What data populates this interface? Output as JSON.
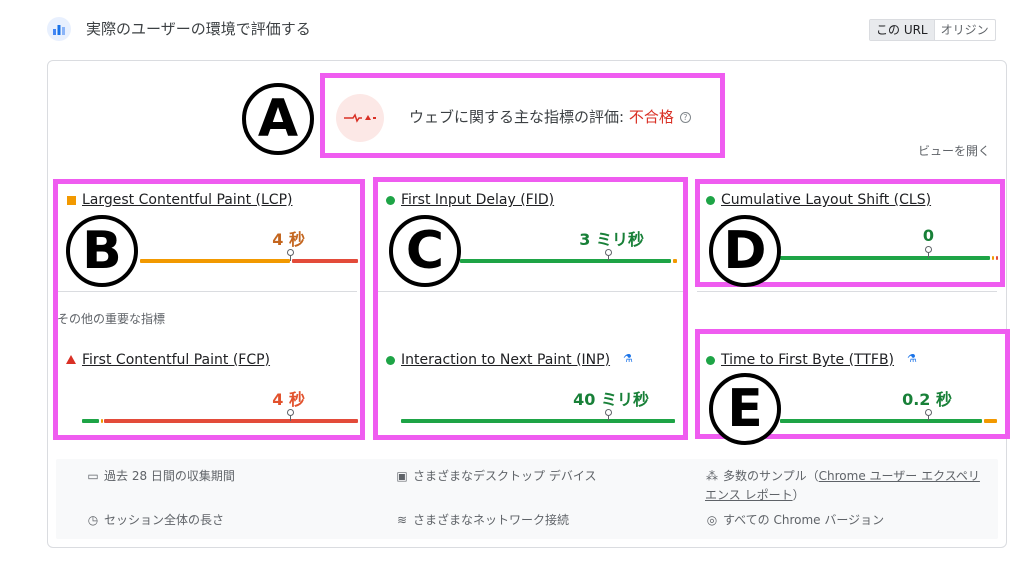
{
  "header": {
    "title": "実際のユーザーの環境で評価する",
    "toggle": [
      "この URL",
      "オリジン"
    ]
  },
  "assessment": {
    "label": "ウェブに関する主な指標の評価:",
    "result": "不合格",
    "help": "?",
    "expand": "ビューを開く"
  },
  "metrics": {
    "lcp": {
      "name": "Largest Contentful Paint (LCP)",
      "value": "4 秒",
      "status": "needs-improvement"
    },
    "fid": {
      "name": "First Input Delay (FID)",
      "value": "3 ミリ秒",
      "status": "good"
    },
    "cls": {
      "name": "Cumulative Layout Shift (CLS)",
      "value": "0",
      "status": "good"
    },
    "fcp": {
      "name": "First Contentful Paint (FCP)",
      "value": "4 秒",
      "status": "poor"
    },
    "inp": {
      "name": "Interaction to Next Paint (INP)",
      "value": "40 ミリ秒",
      "status": "good",
      "experimental": true
    },
    "ttfb": {
      "name": "Time to First Byte (TTFB)",
      "value": "0.2 秒",
      "status": "good",
      "experimental": true
    }
  },
  "other_label": "その他の重要な指標",
  "annotations": {
    "a": "Ⓐ",
    "b": "Ⓑ",
    "c": "Ⓒ",
    "d": "Ⓓ",
    "e": "Ⓔ",
    "box_color": "#ef5cf0"
  },
  "info": {
    "period": "過去 28 日間の収集期間",
    "devices": "さまざまなデスクトップ デバイス",
    "samples_prefix": "多数のサンプル（",
    "samples_link": "Chrome ユーザー エクスペリ",
    "samples_link2": "エンス レポート",
    "samples_suffix": "）",
    "session": "セッション全体の長さ",
    "network": "さまざまなネットワーク接続",
    "versions": "すべての Chrome バージョン"
  },
  "colors": {
    "good": "#1ea446",
    "needs_improvement": "#f29900",
    "poor": "#e34b3a"
  }
}
